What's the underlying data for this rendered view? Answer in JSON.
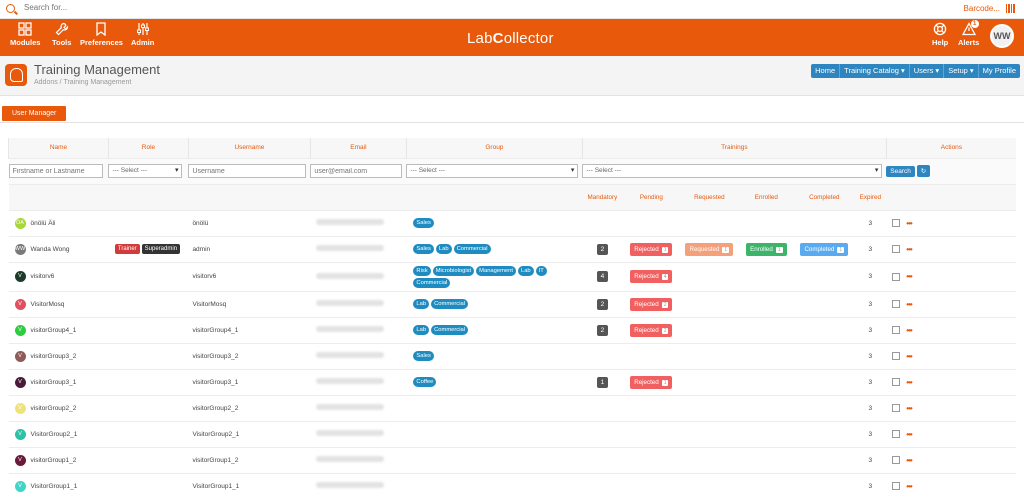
{
  "search": {
    "placeholder": "Search for...",
    "barcode_label": "Barcode..."
  },
  "topnav": {
    "items": [
      {
        "label": "Modules",
        "icon": "modules-grid-icon"
      },
      {
        "label": "Tools",
        "icon": "wrench-icon"
      },
      {
        "label": "Preferences",
        "icon": "bookmark-icon"
      },
      {
        "label": "Admin",
        "icon": "sliders-icon"
      }
    ],
    "logo_prefix": "Lab",
    "logo_suffix": "ollector",
    "help_label": "Help",
    "alerts_label": "Alerts",
    "alerts_count": "1",
    "user_initials": "WW"
  },
  "page": {
    "title": "Training Management",
    "breadcrumb": "Addons / Training Management",
    "menu": [
      "Home",
      "Training Catalog ▾",
      "Users ▾",
      "Setup ▾",
      "My Profile"
    ],
    "tab_label": "User Manager"
  },
  "table": {
    "headers": [
      "Name",
      "Role",
      "Username",
      "Email",
      "Group",
      "Trainings",
      "Actions"
    ],
    "filters": {
      "name_placeholder": "Firstname or Lastname",
      "role_select": "--- Select ---",
      "username_placeholder": "Username",
      "email_placeholder": "user@email.com",
      "group_select": "--- Select ---",
      "trainings_select": "--- Select ---",
      "search_btn": "Search",
      "reset_icon": "↻"
    },
    "sub_headers": [
      "Mandatory",
      "Pending",
      "Requested",
      "Enrolled",
      "Completed",
      "Expired"
    ],
    "rows": [
      {
        "initials": "ÖA",
        "color": "#a8d63b",
        "name": "önölü Äli",
        "roles": [],
        "username": "önölü",
        "groups": [
          "Sales"
        ],
        "mandatory": "",
        "pending": "",
        "requested": "",
        "enrolled": "",
        "completed": "",
        "expired": "3"
      },
      {
        "initials": "WW",
        "color": "#7a7a7a",
        "name": "Wanda Wong",
        "roles": [
          "Trainer",
          "Superadmin"
        ],
        "username": "admin",
        "groups": [
          "Sales",
          "Lab",
          "Commercial"
        ],
        "mandatory": "2",
        "pending": "Rejected|1",
        "requested": "Requested|1",
        "enrolled": "Enrolled|1",
        "completed": "Completed|1",
        "expired": "3"
      },
      {
        "initials": "V",
        "color": "#1d3b2a",
        "name": "visitorv6",
        "roles": [],
        "username": "visitorv6",
        "groups": [
          "Risk",
          "Microbiologist",
          "Management",
          "Lab",
          "IT",
          "Commercial"
        ],
        "mandatory": "4",
        "pending": "Rejected|4",
        "requested": "",
        "enrolled": "",
        "completed": "",
        "expired": "3"
      },
      {
        "initials": "V",
        "color": "#e0505e",
        "name": "VisitorMosq",
        "roles": [],
        "username": "VisitorMosq",
        "groups": [
          "Lab",
          "Commercial"
        ],
        "mandatory": "2",
        "pending": "Rejected|2",
        "requested": "",
        "enrolled": "",
        "completed": "",
        "expired": "3"
      },
      {
        "initials": "V",
        "color": "#2ecc40",
        "name": "visitorGroup4_1",
        "roles": [],
        "username": "visitorGroup4_1",
        "groups": [
          "Lab",
          "Commercial"
        ],
        "mandatory": "2",
        "pending": "Rejected|2",
        "requested": "",
        "enrolled": "",
        "completed": "",
        "expired": "3"
      },
      {
        "initials": "V",
        "color": "#8e5a5a",
        "name": "visitorGroup3_2",
        "roles": [],
        "username": "visitorGroup3_2",
        "groups": [
          "Sales"
        ],
        "mandatory": "",
        "pending": "",
        "requested": "",
        "enrolled": "",
        "completed": "",
        "expired": "3"
      },
      {
        "initials": "V",
        "color": "#4a1a3a",
        "name": "visitorGroup3_1",
        "roles": [],
        "username": "visitorGroup3_1",
        "groups": [
          "Coffee"
        ],
        "mandatory": "1",
        "pending": "Rejected|1",
        "requested": "",
        "enrolled": "",
        "completed": "",
        "expired": "3"
      },
      {
        "initials": "V",
        "color": "#f0e27a",
        "name": "visitorGroup2_2",
        "roles": [],
        "username": "visitorGroup2_2",
        "groups": [],
        "mandatory": "",
        "pending": "",
        "requested": "",
        "enrolled": "",
        "completed": "",
        "expired": "3"
      },
      {
        "initials": "V",
        "color": "#2bc2a8",
        "name": "VisitorGroup2_1",
        "roles": [],
        "username": "VisitorGroup2_1",
        "groups": [],
        "mandatory": "",
        "pending": "",
        "requested": "",
        "enrolled": "",
        "completed": "",
        "expired": "3"
      },
      {
        "initials": "V",
        "color": "#6a1a3a",
        "name": "visitorGroup1_2",
        "roles": [],
        "username": "visitorGroup1_2",
        "groups": [],
        "mandatory": "",
        "pending": "",
        "requested": "",
        "enrolled": "",
        "completed": "",
        "expired": "3"
      },
      {
        "initials": "V",
        "color": "#3ed6c8",
        "name": "VisitorGroup1_1",
        "roles": [],
        "username": "VisitorGroup1_1",
        "groups": [],
        "mandatory": "",
        "pending": "",
        "requested": "",
        "enrolled": "",
        "completed": "",
        "expired": "3"
      }
    ]
  },
  "colors": {
    "brand": "#e8590c",
    "accent_blue": "#2e86c1",
    "trainer": "#d13b3b",
    "superadmin": "#333333",
    "rejected": "#f06060",
    "requested": "#f4a07a",
    "enrolled": "#3cb56a",
    "completed": "#5aaaf0"
  }
}
